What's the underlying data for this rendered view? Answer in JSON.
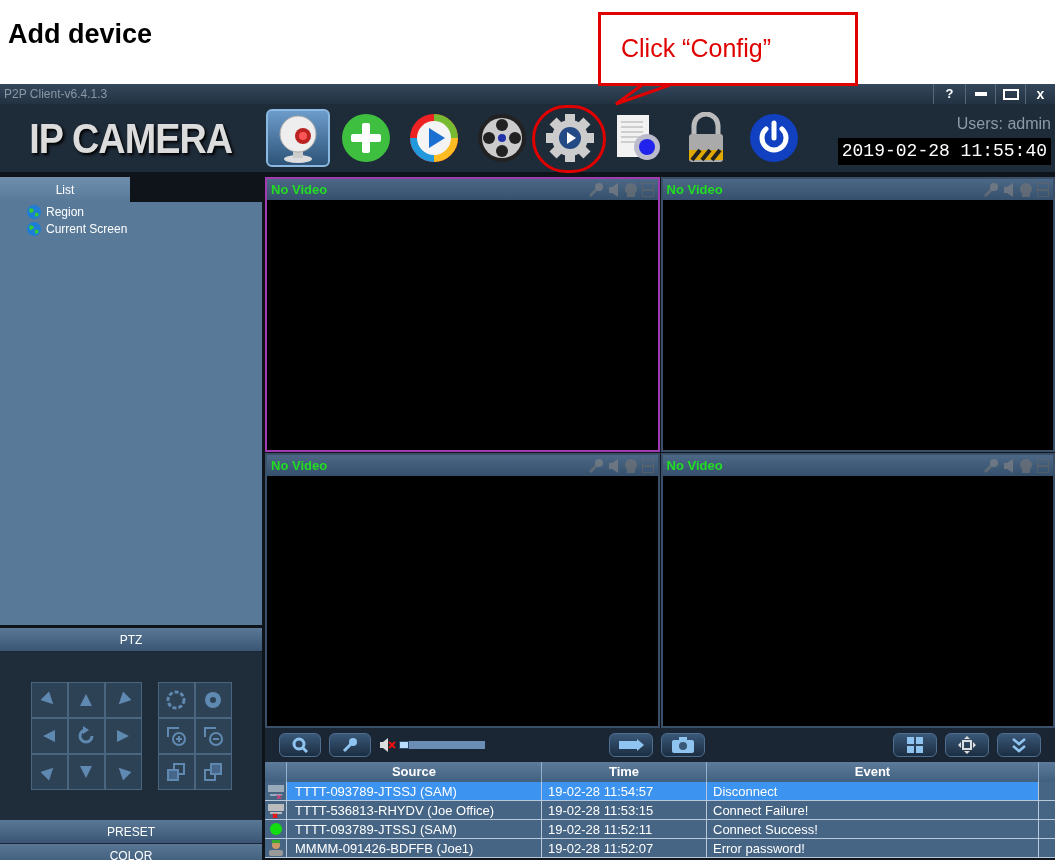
{
  "heading": "Add device",
  "callout": {
    "text": "Click “Config”"
  },
  "window": {
    "title": "P2P Client-v6.4.1.3",
    "help": "?",
    "close": "x"
  },
  "logo": "IP CAMERA",
  "toolbar": [
    {
      "kind": "camera",
      "selected": true,
      "circled": false
    },
    {
      "kind": "add",
      "selected": false,
      "circled": false
    },
    {
      "kind": "play",
      "selected": false,
      "circled": false
    },
    {
      "kind": "reel",
      "selected": false,
      "circled": false
    },
    {
      "kind": "config",
      "selected": false,
      "circled": true
    },
    {
      "kind": "document",
      "selected": false,
      "circled": false
    },
    {
      "kind": "lock",
      "selected": false,
      "circled": false
    },
    {
      "kind": "power",
      "selected": false,
      "circled": false
    }
  ],
  "users": "Users: admin",
  "datetime": "2019-02-28 11:55:40",
  "sidebar": {
    "tab": "List",
    "items": [
      "Region",
      "Current Screen"
    ],
    "sections": [
      "PTZ",
      "PRESET",
      "COLOR"
    ]
  },
  "videos": [
    {
      "label": "No Video",
      "selected": true
    },
    {
      "label": "No Video",
      "selected": false
    },
    {
      "label": "No Video",
      "selected": false
    },
    {
      "label": "No Video",
      "selected": false
    }
  ],
  "volume": {
    "muted": true,
    "level": 0.12
  },
  "events": {
    "columns": [
      "Source",
      "Time",
      "Event"
    ],
    "rows": [
      {
        "kind": "disconnect",
        "source": "TTTT-093789-JTSSJ (SAM)",
        "time": "19-02-28 11:54:57",
        "event": "Disconnect",
        "selected": true
      },
      {
        "kind": "failure",
        "source": "TTTT-536813-RHYDV (Joe Office)",
        "time": "19-02-28 11:53:15",
        "event": "Connect Failure!",
        "selected": false
      },
      {
        "kind": "success",
        "source": "TTTT-093789-JTSSJ (SAM)",
        "time": "19-02-28 11:52:11",
        "event": "Connect Success!",
        "selected": false
      },
      {
        "kind": "password",
        "source": "MMMM-091426-BDFFB (Joe1)",
        "time": "19-02-28 11:52:07",
        "event": "Error password!",
        "selected": false
      }
    ]
  }
}
